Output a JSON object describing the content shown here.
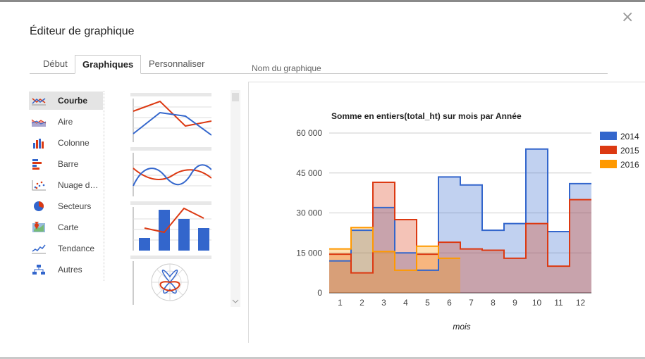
{
  "dialog": {
    "title": "Éditeur de graphique",
    "close_icon": "×"
  },
  "tabs": [
    {
      "label": "Début",
      "active": false
    },
    {
      "label": "Graphiques",
      "active": true
    },
    {
      "label": "Personnaliser",
      "active": false
    }
  ],
  "cutoff_label": "Nom du graphique",
  "chart_types": [
    {
      "label": "Courbe",
      "icon": "line-chart-icon",
      "selected": true
    },
    {
      "label": "Aire",
      "icon": "area-chart-icon",
      "selected": false
    },
    {
      "label": "Colonne",
      "icon": "column-chart-icon",
      "selected": false
    },
    {
      "label": "Barre",
      "icon": "bar-chart-icon",
      "selected": false
    },
    {
      "label": "Nuage d…",
      "icon": "scatter-chart-icon",
      "selected": false
    },
    {
      "label": "Secteurs",
      "icon": "pie-chart-icon",
      "selected": false
    },
    {
      "label": "Carte",
      "icon": "map-chart-icon",
      "selected": false
    },
    {
      "label": "Tendance",
      "icon": "trend-chart-icon",
      "selected": false
    },
    {
      "label": "Autres",
      "icon": "org-chart-icon",
      "selected": false
    }
  ],
  "thumbnails": [
    {
      "name": "line-thumbnail"
    },
    {
      "name": "smooth-line-thumbnail"
    },
    {
      "name": "combo-thumbnail"
    },
    {
      "name": "radar-thumbnail"
    }
  ],
  "colors": {
    "series_2014": "#3366cc",
    "series_2015": "#dc3912",
    "series_2016": "#ff9900"
  },
  "chart_data": {
    "type": "area",
    "title": "Somme en entiers(total_ht) sur mois par Année",
    "xlabel": "mois",
    "ylabel": "",
    "categories": [
      "1",
      "2",
      "3",
      "4",
      "5",
      "6",
      "7",
      "8",
      "9",
      "10",
      "11",
      "12"
    ],
    "ylim": [
      0,
      60000
    ],
    "yticks": [
      0,
      15000,
      30000,
      45000,
      60000
    ],
    "ytick_labels": [
      "0",
      "15 000",
      "30 000",
      "45 000",
      "60 000"
    ],
    "legend_position": "right",
    "stepped": true,
    "series": [
      {
        "name": "2014",
        "color": "#3366cc",
        "values": [
          12000,
          23500,
          32000,
          15000,
          8500,
          43500,
          40500,
          23500,
          26000,
          54000,
          23000,
          41000
        ]
      },
      {
        "name": "2015",
        "color": "#dc3912",
        "values": [
          14500,
          7500,
          41500,
          27500,
          14500,
          19000,
          16500,
          16000,
          13000,
          26000,
          10000,
          35000
        ]
      },
      {
        "name": "2016",
        "color": "#ff9900",
        "values": [
          16500,
          24500,
          15500,
          8500,
          17500,
          13000,
          null,
          null,
          null,
          null,
          null,
          null
        ]
      }
    ]
  }
}
